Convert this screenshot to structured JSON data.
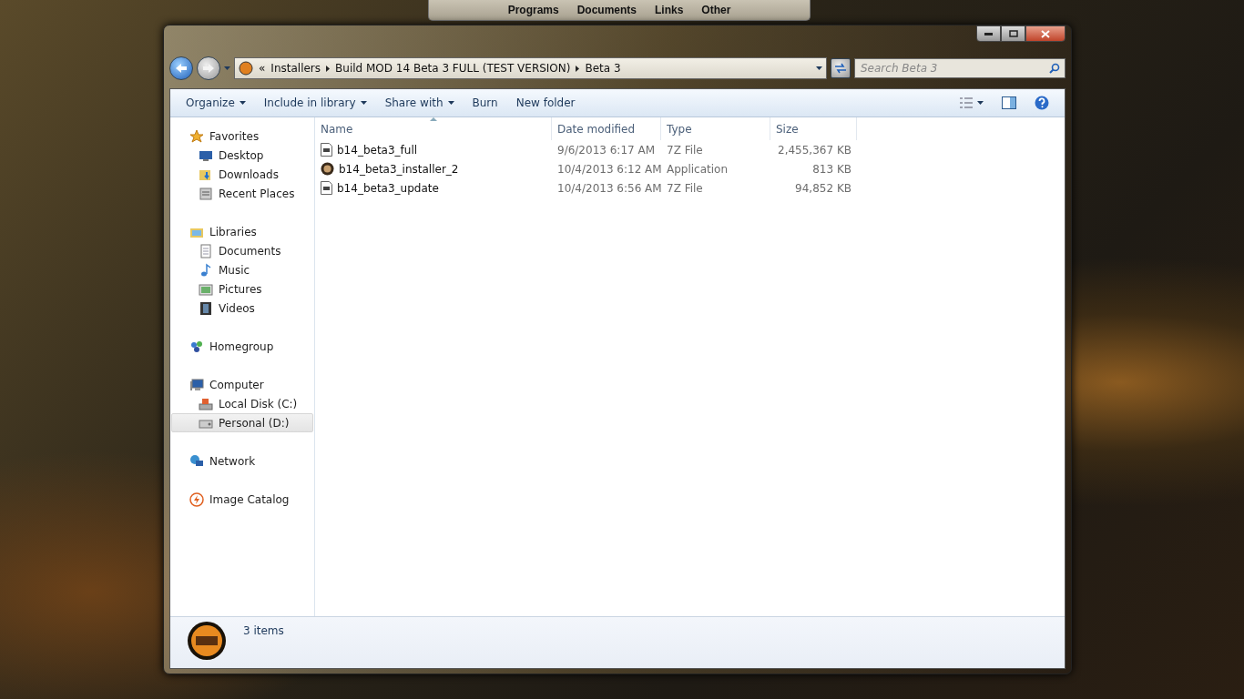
{
  "taskbar_toolbar": {
    "items": [
      "Programs",
      "Documents",
      "Links",
      "Other"
    ]
  },
  "address_bar": {
    "prefix": "«",
    "crumbs": [
      "Installers",
      "Build MOD 14 Beta 3 FULL (TEST VERSION)",
      "Beta 3"
    ]
  },
  "search": {
    "placeholder": "Search Beta 3"
  },
  "toolbar": {
    "commands": [
      {
        "label": "Organize",
        "dropdown": true
      },
      {
        "label": "Include in library",
        "dropdown": true
      },
      {
        "label": "Share with",
        "dropdown": true
      },
      {
        "label": "Burn",
        "dropdown": false
      },
      {
        "label": "New folder",
        "dropdown": false
      }
    ]
  },
  "sidebar": {
    "groups": [
      {
        "label": "Favorites",
        "kind": "star",
        "children": [
          {
            "label": "Desktop",
            "kind": "desktop",
            "selected": false
          },
          {
            "label": "Downloads",
            "kind": "downloads",
            "selected": false
          },
          {
            "label": "Recent Places",
            "kind": "recent",
            "selected": false
          }
        ]
      },
      {
        "label": "Libraries",
        "kind": "library",
        "children": [
          {
            "label": "Documents",
            "kind": "document",
            "selected": false
          },
          {
            "label": "Music",
            "kind": "music",
            "selected": false
          },
          {
            "label": "Pictures",
            "kind": "picture",
            "selected": false
          },
          {
            "label": "Videos",
            "kind": "video",
            "selected": false
          }
        ]
      },
      {
        "label": "Homegroup",
        "kind": "homegroup"
      },
      {
        "label": "Computer",
        "kind": "computer",
        "children": [
          {
            "label": "Local Disk (C:)",
            "kind": "disk",
            "selected": false
          },
          {
            "label": "Personal (D:)",
            "kind": "drive",
            "selected": true
          }
        ]
      },
      {
        "label": "Network",
        "kind": "network"
      },
      {
        "label": "Image Catalog",
        "kind": "catalog"
      }
    ]
  },
  "table": {
    "columns": [
      {
        "label": "Name",
        "sorted": true
      },
      {
        "label": "Date modified",
        "sorted": false
      },
      {
        "label": "Type",
        "sorted": false
      },
      {
        "label": "Size",
        "sorted": false
      }
    ],
    "rows": [
      {
        "kind": "archive",
        "name": "b14_beta3_full",
        "date": "9/6/2013 6:17 AM",
        "type": "7Z File",
        "size": "2,455,367 KB"
      },
      {
        "kind": "app",
        "name": "b14_beta3_installer_2",
        "date": "10/4/2013 6:12 AM",
        "type": "Application",
        "size": "813 KB"
      },
      {
        "kind": "archive",
        "name": "b14_beta3_update",
        "date": "10/4/2013 6:56 AM",
        "type": "7Z File",
        "size": "94,852 KB"
      }
    ]
  },
  "status_bar": {
    "count": "3 items"
  }
}
